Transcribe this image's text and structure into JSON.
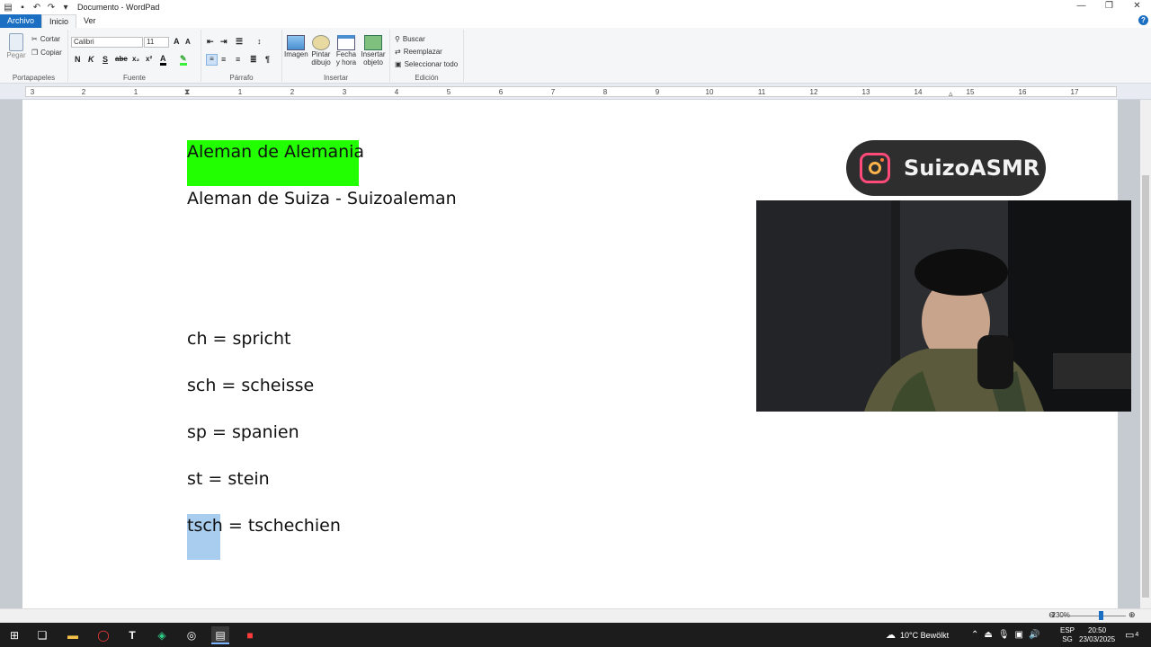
{
  "window": {
    "title": "Documento - WordPad",
    "minimize": "—",
    "maximize": "❐",
    "close": "✕"
  },
  "tabs": [
    "Archivo",
    "Inicio",
    "Ver"
  ],
  "ribbon": {
    "clipboard": {
      "label": "Portapapeles",
      "paste": "Pegar",
      "cut": "Cortar",
      "copy": "Copiar"
    },
    "font": {
      "label": "Fuente",
      "family": "Calibri",
      "size": "11"
    },
    "paragraph": {
      "label": "Párrafo"
    },
    "insert": {
      "label": "Insertar",
      "image": "Imagen",
      "paint_line1": "Pintar",
      "paint_line2": "dibujo",
      "date_line1": "Fecha",
      "date_line2": "y hora",
      "object_line1": "Insertar",
      "object_line2": "objeto"
    },
    "edit": {
      "label": "Edición",
      "find": "Buscar",
      "replace": "Reemplazar",
      "select_all": "Seleccionar todo"
    }
  },
  "ruler": {
    "ticks": [
      "3",
      "2",
      "1",
      "1",
      "2",
      "3",
      "4",
      "5",
      "6",
      "7",
      "8",
      "9",
      "10",
      "11",
      "12",
      "13",
      "14",
      "15",
      "16",
      "17"
    ]
  },
  "document": {
    "line1": "Aleman de Alemania",
    "line2": "Aleman de Suiza - Suizoaleman",
    "line3": "ch = spricht",
    "line4": "sch = scheisse",
    "line5": "sp = spanien",
    "line6": "st = stein",
    "line7": "tsch = tschechien"
  },
  "overlay": {
    "handle": "SuizoASMR"
  },
  "status": {
    "zoom": "230%"
  },
  "taskbar": {
    "weather": "10°C  Bewölkt",
    "lang1": "ESP",
    "lang2": "SG",
    "time": "20:50",
    "date": "23/03/2025",
    "notifications": "4"
  },
  "colors": {
    "highlight": "#22ff00",
    "selection": "#a9cdee",
    "accent": "#1b6fc2"
  }
}
